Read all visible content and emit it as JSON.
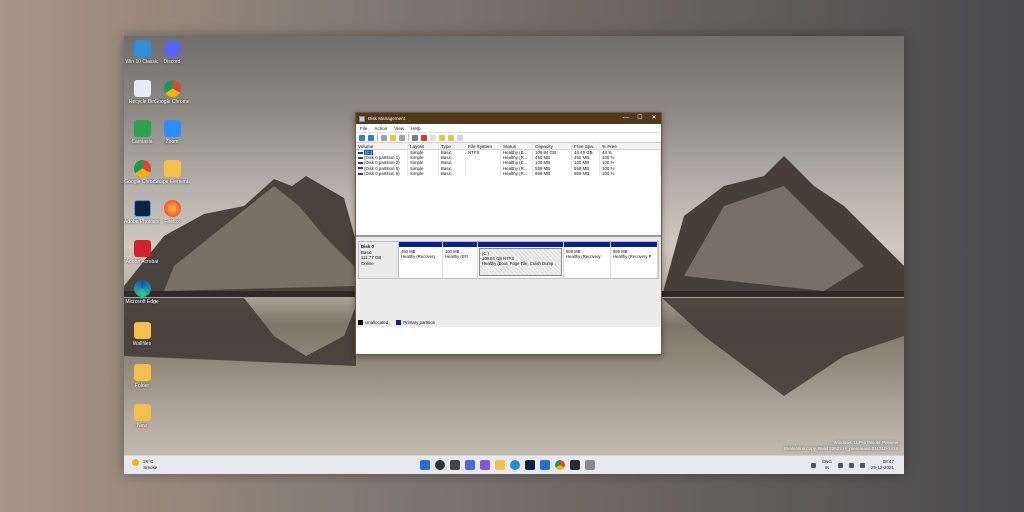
{
  "desktop": {
    "icons": [
      {
        "label": "Win 10 Classic"
      },
      {
        "label": "Discord"
      },
      {
        "label": "Recycle Bin"
      },
      {
        "label": "Google Chrome"
      },
      {
        "label": "Camtasia"
      },
      {
        "label": "Zoom"
      },
      {
        "label": "Google Chrome"
      },
      {
        "label": "Shape Elements"
      },
      {
        "label": "Adobe Photoshop"
      },
      {
        "label": "Firefox"
      },
      {
        "label": "Adobe Acrobat"
      },
      {
        "label": "Microsoft Edge"
      },
      {
        "label": "Wallfiles"
      },
      {
        "label": "Folder"
      },
      {
        "label": "New"
      }
    ],
    "watermark_line1": "Windows 11 Pro Insider Preview",
    "watermark_line2": "Evaluation copy. Build 22523.rs_prerelease.211210-1418"
  },
  "taskbar": {
    "weather_temp": "26°C",
    "weather_desc": "Smoke",
    "lang_line1": "ENG",
    "lang_line2": "IN",
    "time": "08:47",
    "date": "29-12-2021"
  },
  "window": {
    "title": "Disk Management",
    "controls": [
      "—",
      "☐",
      "✕"
    ],
    "menu": [
      "File",
      "Action",
      "View",
      "Help"
    ],
    "columns": [
      "Volume",
      "Layout",
      "Type",
      "File System",
      "Status",
      "Capacity",
      "Free Spa...",
      "% Free"
    ],
    "rows": [
      [
        "(C:)",
        "Simple",
        "Basic",
        "NTFS",
        "Healthy (B...",
        "109.84 GB",
        "48.49 GB",
        "44 %"
      ],
      [
        "(Disk 0 partition 1)",
        "Simple",
        "Basic",
        "",
        "Healthy (R...",
        "450 MB",
        "450 MB",
        "100 %"
      ],
      [
        "(Disk 0 partition 2)",
        "Simple",
        "Basic",
        "",
        "Healthy (E...",
        "100 MB",
        "100 MB",
        "100 %"
      ],
      [
        "(Disk 0 partition 5)",
        "Simple",
        "Basic",
        "",
        "Healthy (R...",
        "559 MB",
        "559 MB",
        "100 %"
      ],
      [
        "(Disk 0 partition 6)",
        "Simple",
        "Basic",
        "",
        "Healthy (R...",
        "869 MB",
        "869 MB",
        "100 %"
      ]
    ],
    "disk": {
      "name": "Disk 0",
      "type": "Basic",
      "size": "111.77 GB",
      "status": "Online"
    },
    "partitions": [
      {
        "label": "",
        "size": "450 MB",
        "status": "Healthy (Recovery"
      },
      {
        "label": "",
        "size": "100 MB",
        "status": "Healthy (EFI"
      },
      {
        "label": "(C:)",
        "size": "109.84 GB NTFS",
        "status": "Healthy (Boot, Page File, Crash Dump"
      },
      {
        "label": "",
        "size": "559 MB",
        "status": "Healthy (Recovery"
      },
      {
        "label": "",
        "size": "869 MB",
        "status": "Healthy (Recovery P"
      }
    ],
    "legend": [
      {
        "label": "Unallocated",
        "color": "#000000"
      },
      {
        "label": "Primary partition",
        "color": "#0b1c9b"
      }
    ]
  }
}
